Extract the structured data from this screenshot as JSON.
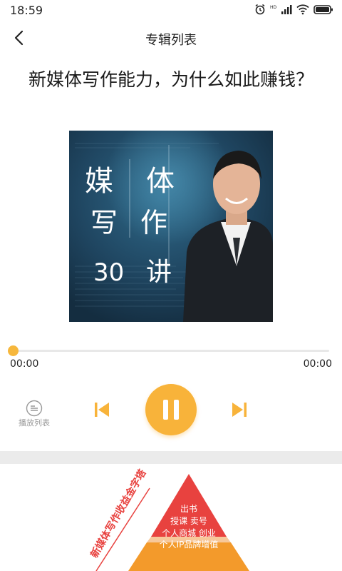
{
  "status_bar": {
    "time": "18:59",
    "icons": [
      "alarm-icon",
      "hd-icon",
      "signal-icon",
      "wifi-icon",
      "battery-icon"
    ]
  },
  "nav": {
    "title": "专辑列表",
    "back_icon": "chevron-left-icon"
  },
  "album": {
    "title": "新媒体写作能力，为什么如此赚钱？",
    "cover_text": {
      "c1": "媒",
      "c2": "体",
      "c3": "写",
      "c4": "作",
      "c5": "30",
      "c6": "讲"
    }
  },
  "player": {
    "current_time": "00:00",
    "total_time": "00:00",
    "progress": 0.0,
    "state": "playing",
    "playlist_label": "播放列表"
  },
  "content": {
    "diagonal_caption": "新媒体写作收益金字塔",
    "pyramid_lines": [
      "出书",
      "授课  卖号",
      "个人商城  创业",
      "个人IP品牌增值"
    ]
  },
  "colors": {
    "accent": "#f8b33a",
    "pyramid_red": "#e8423f",
    "pyramid_orange": "#f39a2b",
    "cover_bg": "#1d3f5a",
    "divider": "#ebebeb"
  }
}
